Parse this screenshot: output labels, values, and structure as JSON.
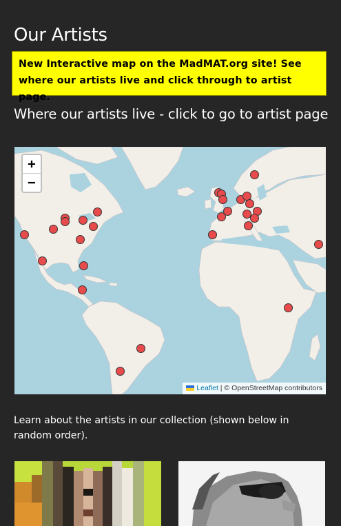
{
  "page": {
    "heading": "Our Artists",
    "banner_text": "New Interactive map on the MadMAT.org site!  See where our artists live and click through to artist page.",
    "map_heading": "Where our artists live - click to go to artist page",
    "intro_text": "Learn about the artists in our collection (shown below in random order)."
  },
  "map": {
    "zoom_in_label": "+",
    "zoom_out_label": "−",
    "attribution_leaflet": "Leaflet",
    "attribution_rest": " | © OpenStreetMap contributors",
    "colors": {
      "water": "#aad3df",
      "land": "#f2efe9",
      "marker": "#e84b4b"
    },
    "marker_count": 35
  },
  "artist_cards": [
    {
      "name": "artist-portrait-left",
      "description_icon": "pixelated-portrait"
    },
    {
      "name": "artist-portrait-right",
      "description_icon": "man-with-sunglasses-portrait"
    }
  ]
}
